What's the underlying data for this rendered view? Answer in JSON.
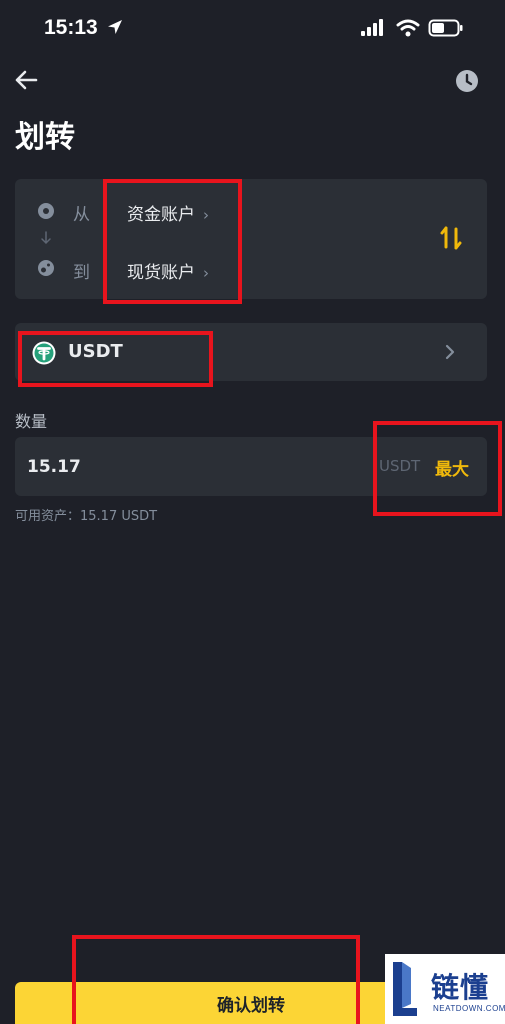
{
  "status_bar": {
    "time": "15:13",
    "icons": [
      "location-arrow-icon",
      "signal-icon",
      "wifi-icon",
      "battery-icon"
    ]
  },
  "header": {
    "back_icon": "back-arrow-icon",
    "history_icon": "clock-icon",
    "title": "划转"
  },
  "transfer": {
    "from_label": "从",
    "from_account": "资金账户",
    "to_label": "到",
    "to_account": "现货账户",
    "swap_icon": "swap-vertical-icon"
  },
  "coin": {
    "name": "USDT",
    "icon": "tether-icon"
  },
  "amount": {
    "label": "数量",
    "value": "15.17",
    "unit": "USDT",
    "max_label": "最大"
  },
  "available": {
    "text": "可用资产：15.17 USDT"
  },
  "confirm": {
    "label": "确认划转"
  },
  "watermark": {
    "text": "链懂",
    "sub": "NEATDOWN.COM"
  },
  "colors": {
    "background": "#1e2028",
    "card": "#2b2f36",
    "accent": "#f0b90b",
    "button": "#fcd535",
    "highlight": "#e8141d"
  }
}
